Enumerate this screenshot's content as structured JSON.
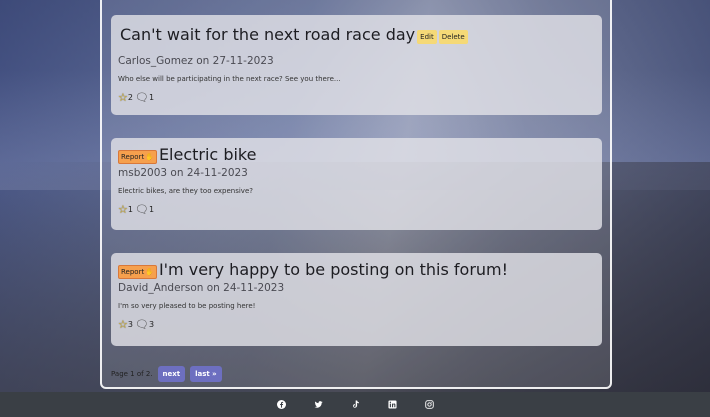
{
  "posts": [
    {
      "title": "Can't wait for the next road race day",
      "meta": "Carlos_Gomez on 27-11-2023",
      "body": "Who else will be participating in the next race? See you there...",
      "likes": "2",
      "comments": "1",
      "edit_label": "Edit",
      "delete_label": "Delete"
    },
    {
      "title": "Electric bike",
      "meta": "msb2003 on 24-11-2023",
      "body": "Electric bikes, are they too expensive?",
      "likes": "1",
      "comments": "1",
      "report_label": "Report"
    },
    {
      "title": "I'm very happy to be posting on this forum!",
      "meta": "David_Anderson on 24-11-2023",
      "body": "I'm so very pleased to be posting here!",
      "likes": "3",
      "comments": "3",
      "report_label": "Report"
    }
  ],
  "pagination": {
    "text": "Page 1 of 2.",
    "next_label": "next",
    "last_label": "last »"
  },
  "footer": {
    "icons": [
      "facebook-icon",
      "twitter-icon",
      "tiktok-icon",
      "linkedin-icon",
      "instagram-icon"
    ]
  },
  "colors": {
    "accent": "#6d6fc0",
    "edit": "#f5d977",
    "report": "#f6a04d",
    "footer": "#3a3f45"
  }
}
